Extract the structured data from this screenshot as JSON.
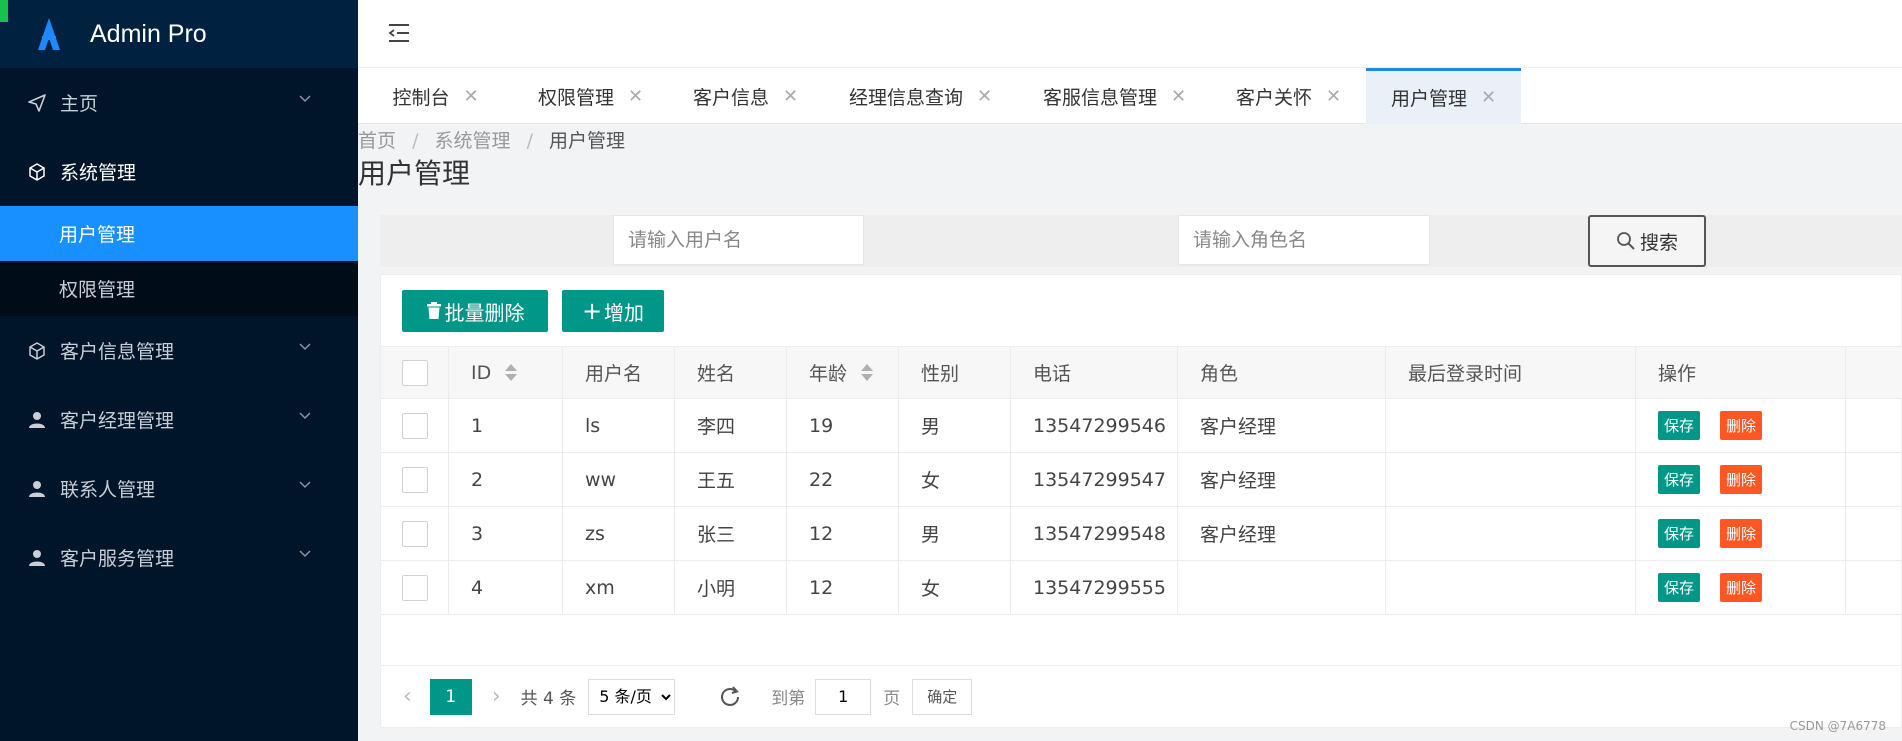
{
  "brand": {
    "title": "Admin Pro"
  },
  "sidebar": {
    "items": [
      {
        "label": "主页",
        "icon": "send-icon",
        "has_children": true
      },
      {
        "label": "系统管理",
        "icon": "cube-icon",
        "has_children": true,
        "children": [
          {
            "label": "用户管理",
            "active": true
          },
          {
            "label": "权限管理",
            "active": false
          }
        ]
      },
      {
        "label": "客户信息管理",
        "icon": "cube-icon",
        "has_children": true
      },
      {
        "label": "客户经理管理",
        "icon": "user-icon",
        "has_children": true
      },
      {
        "label": "联系人管理",
        "icon": "user-icon",
        "has_children": true
      },
      {
        "label": "客户服务管理",
        "icon": "user-icon",
        "has_children": true
      }
    ]
  },
  "tabs": [
    {
      "label": "控制台",
      "close": "✕"
    },
    {
      "label": "权限管理",
      "close": "✕"
    },
    {
      "label": "客户信息",
      "close": "✕"
    },
    {
      "label": "经理信息查询",
      "close": "✕"
    },
    {
      "label": "客服信息管理",
      "close": "✕"
    },
    {
      "label": "客户关怀",
      "close": "✕"
    },
    {
      "label": "用户管理",
      "close": "✕",
      "active": true
    }
  ],
  "breadcrumb": {
    "items": [
      "首页",
      "系统管理",
      "用户管理"
    ],
    "sep": "/"
  },
  "page_title": "用户管理",
  "search": {
    "username_placeholder": "请输入用户名",
    "role_placeholder": "请输入角色名",
    "button_label": "搜索"
  },
  "toolbar": {
    "batch_delete_label": "批量删除",
    "add_label": "增加"
  },
  "table": {
    "columns": [
      "ID",
      "用户名",
      "姓名",
      "年龄",
      "性别",
      "电话",
      "角色",
      "最后登录时间",
      "操作"
    ],
    "rows": [
      {
        "id": "1",
        "username": "ls",
        "name": "李四",
        "age": "19",
        "gender": "男",
        "phone": "13547299546",
        "role": "客户经理",
        "last_login": ""
      },
      {
        "id": "2",
        "username": "ww",
        "name": "王五",
        "age": "22",
        "gender": "女",
        "phone": "13547299547",
        "role": "客户经理",
        "last_login": ""
      },
      {
        "id": "3",
        "username": "zs",
        "name": "张三",
        "age": "12",
        "gender": "男",
        "phone": "13547299548",
        "role": "客户经理",
        "last_login": ""
      },
      {
        "id": "4",
        "username": "xm",
        "name": "小明",
        "age": "12",
        "gender": "女",
        "phone": "13547299555",
        "role": "",
        "last_login": ""
      }
    ],
    "save_label": "保存",
    "delete_label": "删除"
  },
  "pager": {
    "current_page": "1",
    "total_text": "共 4 条",
    "page_size": "5 条/页",
    "goto_prefix": "到第",
    "goto_value": "1",
    "goto_suffix": "页",
    "confirm_label": "确定"
  },
  "watermark": "CSDN @7A6778",
  "colors": {
    "sidebar": "#001529",
    "active": "#1890ff",
    "primary": "#009688",
    "danger": "#ff5722"
  }
}
